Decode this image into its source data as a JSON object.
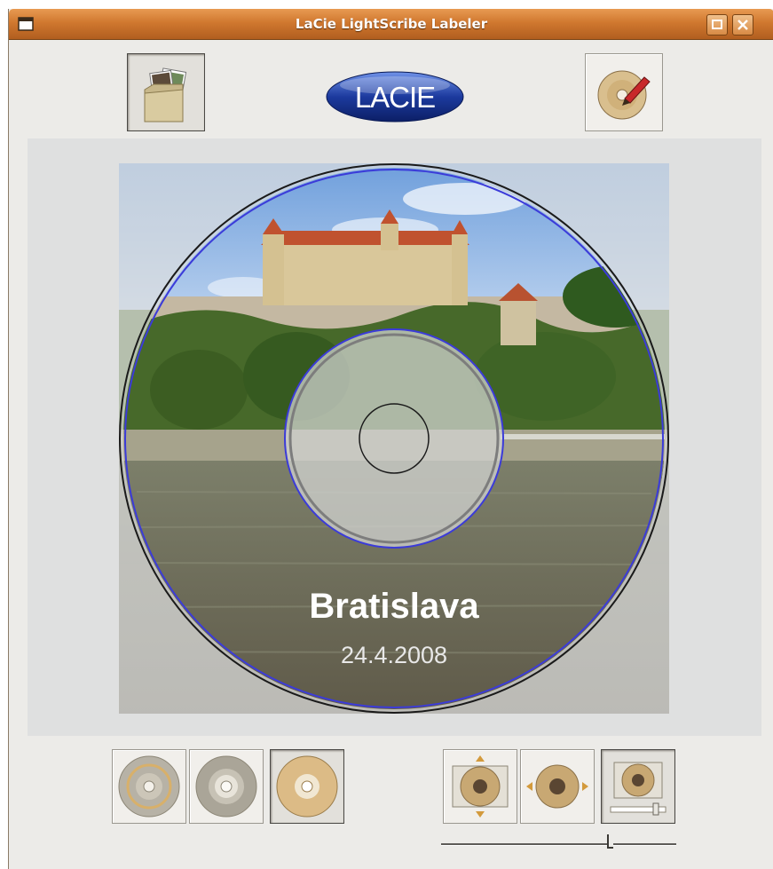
{
  "window": {
    "title": "LaCie LightScribe Labeler"
  },
  "toolbar": {
    "logo_text": "LACIE"
  },
  "label": {
    "title": "Bratislava",
    "date": "24.4.2008",
    "colors": {
      "disc_outline": "#1a1a1a",
      "guide_circle": "#3b3bd9",
      "hub_fill": "#d6d7d6"
    }
  },
  "bottom_bar": {
    "label_mode_selected": "title",
    "image_mode_selected": "zoom",
    "zoom_level": 0.72
  },
  "colors": {
    "titlebar_accent": "#d0782f",
    "window_bg": "#ecebe8",
    "lacie_blue": "#1c3a9e"
  }
}
